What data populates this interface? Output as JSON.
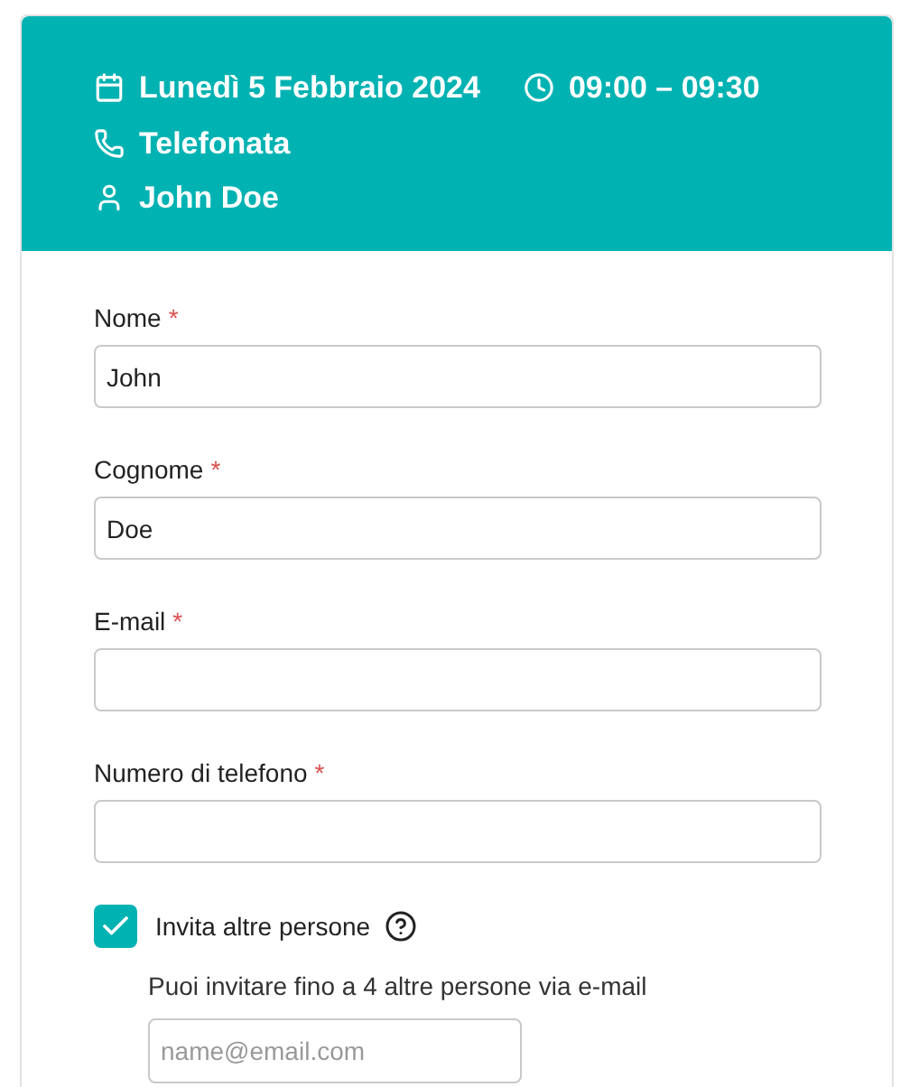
{
  "header": {
    "date": "Lunedì 5 Febbraio 2024",
    "time": "09:00 – 09:30",
    "type": "Telefonata",
    "person": "John Doe"
  },
  "fields": [
    {
      "label": "Nome",
      "required_mark": "*",
      "value": "John"
    },
    {
      "label": "Cognome",
      "required_mark": "*",
      "value": "Doe"
    },
    {
      "label": "E-mail",
      "required_mark": "*"
    },
    {
      "label": "Numero di telefono",
      "required_mark": "*"
    }
  ],
  "invite": {
    "label": "Invita altre persone",
    "checked": true,
    "hint": "Puoi invitare fino a 4 altre persone via e-mail",
    "placeholder": "name@email.com"
  }
}
